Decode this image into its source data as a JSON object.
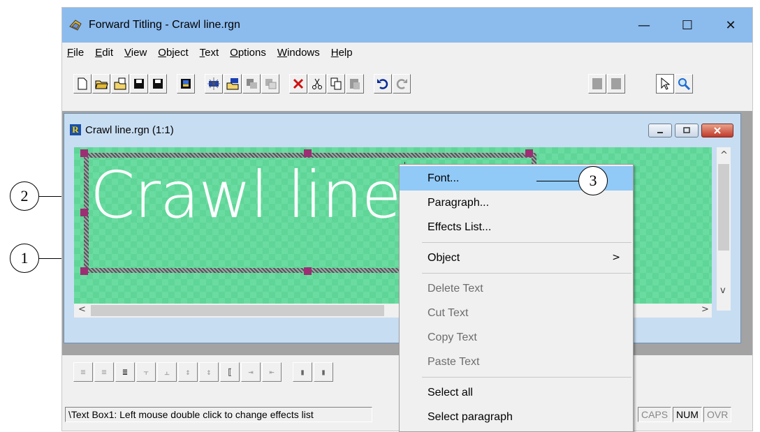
{
  "window": {
    "title": "Forward Titling - Crawl line.rgn",
    "controls": [
      "—",
      "☐",
      "✕"
    ]
  },
  "menubar": [
    "File",
    "Edit",
    "View",
    "Object",
    "Text",
    "Options",
    "Windows",
    "Help"
  ],
  "child": {
    "title": "Crawl line.rgn  (1:1)",
    "icon_letter": "R"
  },
  "canvas": {
    "text": "Crawl line",
    "colors": {
      "bg": "#5fd597",
      "handle": "#9c2f73"
    }
  },
  "context_menu": {
    "items": [
      {
        "label": "Font...",
        "state": "highlighted"
      },
      {
        "label": "Paragraph..."
      },
      {
        "label": "Effects List..."
      },
      {
        "separator": true
      },
      {
        "label": "Object",
        "submenu_arrow": ">"
      },
      {
        "separator": true
      },
      {
        "label": "Delete Text",
        "state": "disabled"
      },
      {
        "label": "Cut Text",
        "state": "disabled"
      },
      {
        "label": "Copy Text",
        "state": "disabled"
      },
      {
        "label": "Paste Text",
        "state": "disabled"
      },
      {
        "separator": true
      },
      {
        "label": "Select all"
      },
      {
        "label": "Select paragraph"
      }
    ]
  },
  "status": {
    "message": "\\Text Box1: Left mouse double click to change effects list",
    "indicators": [
      "CAPS",
      "NUM",
      "OVR"
    ]
  },
  "callouts": [
    "1",
    "2",
    "3"
  ]
}
